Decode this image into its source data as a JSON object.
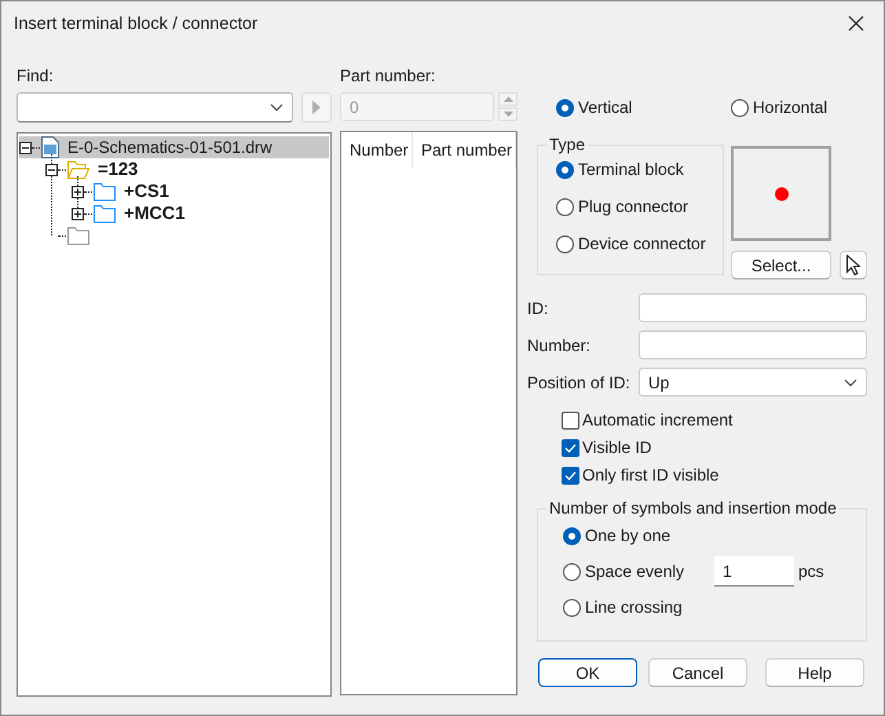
{
  "window": {
    "title": "Insert terminal block / connector"
  },
  "find": {
    "label": "Find:"
  },
  "go_button": {
    "disabled": true
  },
  "tree": {
    "items": [
      {
        "label": "E-0-Schematics-01-501.drw",
        "kind": "document",
        "selected": true,
        "bold": false,
        "leaf": false,
        "expanded": true,
        "children": [
          {
            "label": "=123",
            "kind": "open-folder",
            "selected": false,
            "bold": true,
            "leaf": false,
            "expanded": true,
            "children": [
              {
                "label": "+CS1",
                "kind": "folder",
                "selected": false,
                "bold": true,
                "leaf": false,
                "expanded": false
              },
              {
                "label": "+MCC1",
                "kind": "folder",
                "selected": false,
                "bold": true,
                "leaf": false,
                "expanded": false
              }
            ]
          },
          {
            "kind": "empty-folder",
            "selected": false,
            "leaf": true
          }
        ]
      }
    ]
  },
  "part_number": {
    "label": "Part number:",
    "value": "0",
    "disabled": true
  },
  "parts_table": {
    "columns": [
      "Number",
      "Part number"
    ]
  },
  "orientation": [
    {
      "label": "Vertical",
      "selected": true
    },
    {
      "label": "Horizontal",
      "selected": false
    }
  ],
  "type": {
    "title": "Type",
    "options": [
      {
        "label": "Terminal block",
        "selected": true
      },
      {
        "label": "Plug connector",
        "selected": false
      },
      {
        "label": "Device connector",
        "selected": false
      }
    ]
  },
  "select_button": {
    "label": "Select..."
  },
  "fields": [
    {
      "label": "ID:",
      "kind": "text"
    },
    {
      "label": "Number:",
      "kind": "text"
    },
    {
      "label": "Position of ID:",
      "kind": "dropdown",
      "value": "Up"
    }
  ],
  "checkboxes": [
    {
      "label": "Automatic increment",
      "checked": false
    },
    {
      "label": "Visible ID",
      "checked": true
    },
    {
      "label": "Only first ID visible",
      "checked": true
    }
  ],
  "insertion": {
    "title": "Number of symbols and insertion mode",
    "options": [
      {
        "label": "One by one",
        "selected": true
      },
      {
        "label": "Space evenly",
        "selected": false,
        "count": "1",
        "unit": "pcs"
      },
      {
        "label": "Line crossing",
        "selected": false
      }
    ]
  },
  "buttons": [
    {
      "label": "OK",
      "default": true
    },
    {
      "label": "Cancel",
      "default": false
    },
    {
      "label": "Help",
      "default": false
    }
  ]
}
